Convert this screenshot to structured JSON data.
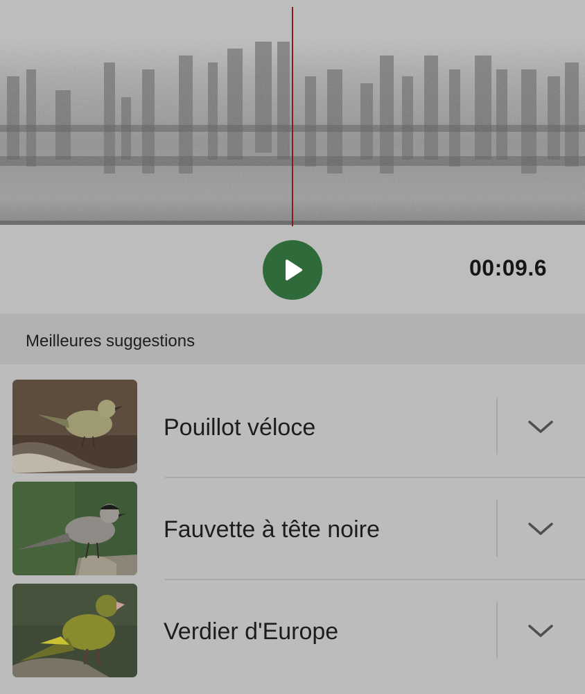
{
  "player": {
    "timecode": "00:09.6",
    "play_icon": "play-icon",
    "accent_color": "#2f6b3a",
    "playhead_color": "#8b1a1a"
  },
  "suggestions": {
    "title": "Meilleures suggestions",
    "items": [
      {
        "name": "Pouillot véloce",
        "icon": "chevron-down-icon"
      },
      {
        "name": "Fauvette à tête noire",
        "icon": "chevron-down-icon"
      },
      {
        "name": "Verdier d'Europe",
        "icon": "chevron-down-icon"
      }
    ]
  }
}
